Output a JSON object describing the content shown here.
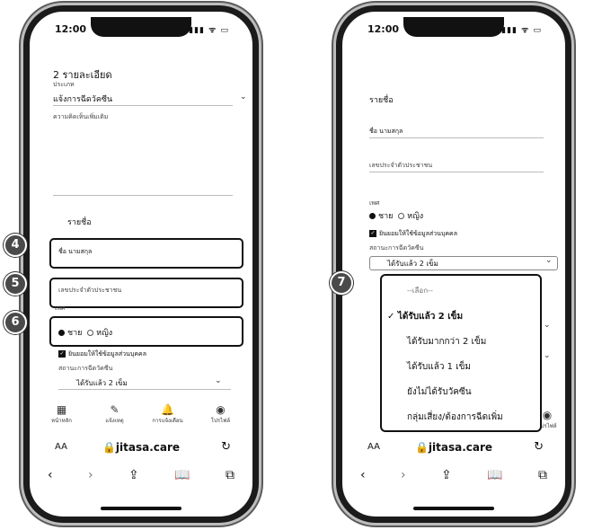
{
  "left_phone": {
    "status": {
      "time": "12:00",
      "icons": "▮▮▮ ᯤ ▭"
    },
    "header_count": "2 รายละเอียด",
    "type_label": "ประเภท",
    "type_value": "แจ้งการฉีดวัคซีน",
    "comment_placeholder": "ความคิดเห็นเพิ่มเติม",
    "list_title": "รายชื่อ",
    "name_field": "ชื่อ นามสกุล",
    "id_field": "เลขประจำตัวประชาชน",
    "gender_label": "เพศ",
    "gender_male": "ชาย",
    "gender_female": "หญิง",
    "consent_text": "ยินยอมให้ใช้ข้อมูลส่วนบุคคล",
    "vaccine_label": "สถานะการฉีดวัคซีน",
    "vaccine_value": "ได้รับแล้ว 2 เข็ม",
    "nav": [
      {
        "icon": "▦",
        "label": "หน้าหลัก"
      },
      {
        "icon": "✎",
        "label": "แจ้งเหตุ"
      },
      {
        "icon": "🔔",
        "label": "การแจ้งเตือน"
      },
      {
        "icon": "◉",
        "label": "โปรไฟล์"
      }
    ],
    "url": "jitasa.care",
    "aa": "AA",
    "callouts": [
      "4",
      "5",
      "6"
    ]
  },
  "right_phone": {
    "status": {
      "time": "12:00",
      "icons": "▮▮▮ ᯤ ▭"
    },
    "list_title": "รายชื่อ",
    "name_field": "ชื่อ นามสกุล",
    "id_field": "เลขประจำตัวประชาชน",
    "gender_label": "เพศ",
    "gender_male": "ชาย",
    "gender_female": "หญิง",
    "consent_text": "ยินยอมให้ใช้ข้อมูลส่วนบุคคล",
    "vaccine_label": "สถานะการฉีดวัคซีน",
    "vaccine_value": "ได้รับแล้ว 2 เข็ม",
    "dropdown_options": [
      {
        "label": "--เลือก--",
        "selected": false
      },
      {
        "label": "ได้รับแล้ว 2 เข็ม",
        "selected": true
      },
      {
        "label": "ได้รับมากกว่า 2 เข็ม",
        "selected": false
      },
      {
        "label": "ได้รับแล้ว 1 เข็ม",
        "selected": false
      },
      {
        "label": "ยังไม่ได้รับวัคซีน",
        "selected": false
      },
      {
        "label": "กลุ่มเสี่ยง/ต้องการฉีดเพิ่ม",
        "selected": false
      }
    ],
    "checkmark": "✓",
    "nav_last": {
      "icon": "◉",
      "label": "โปรไฟล์"
    },
    "url": "jitasa.care",
    "aa": "AA",
    "callout": "7"
  }
}
